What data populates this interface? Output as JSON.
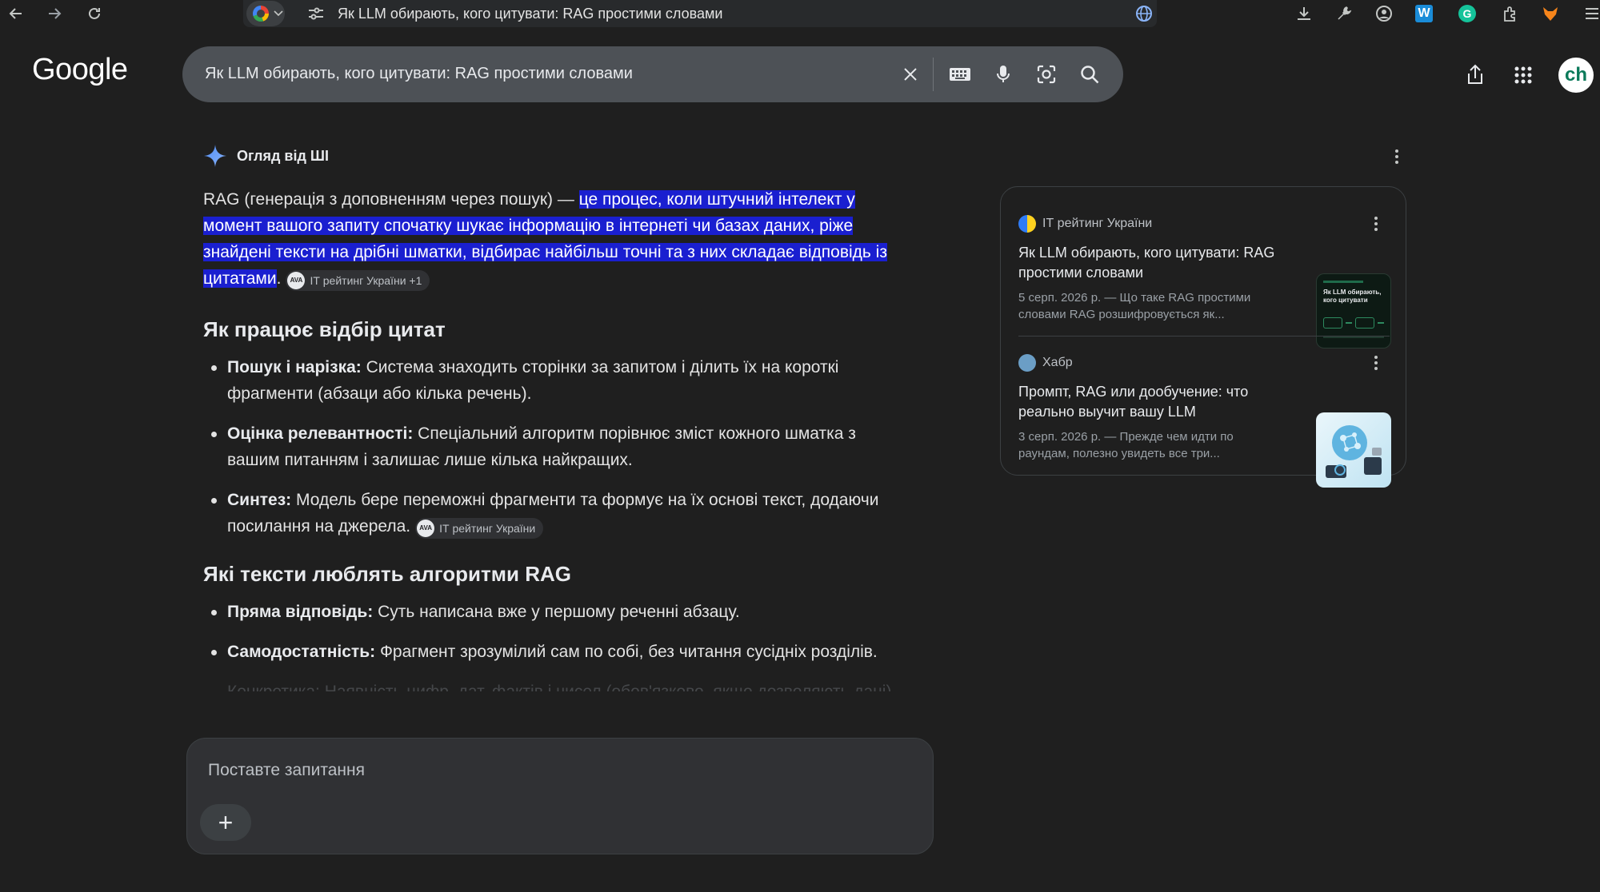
{
  "browser": {
    "tab_title": "Як LLM обирають, кого цитувати: RAG простими словами"
  },
  "google": {
    "logo": "Google",
    "search_query": "Як LLM обирають, кого цитувати: RAG простими словами",
    "avatar_text": "ch"
  },
  "ai_overview": {
    "title": "Огляд від ШІ",
    "intro_plain": "RAG (генерація з доповненням через пошук) — ",
    "intro_highlight": "це процес, коли штучний інтелект у момент вашого запиту спочатку шукає інформацію в інтернеті чи базах даних, ріже знайдені тексти на дрібні шматки, відбирає найбільш точні та з них складає відповідь із цитатами",
    "intro_end": ".",
    "intro_cite": "ІТ рейтинг України +1",
    "cite_badge": "AVA",
    "section1_title": "Як працює відбір цитат",
    "section1_items": [
      {
        "bold": "Пошук і нарізка:",
        "text": " Система знаходить сторінки за запитом і ділить їх на короткі фрагменти (абзаци або кілька речень)."
      },
      {
        "bold": "Оцінка релевантності:",
        "text": " Спеціальний алгоритм порівнює зміст кожного шматка з вашим питанням і залишає лише кілька найкращих."
      },
      {
        "bold": "Синтез:",
        "text": " Модель бере переможні фрагменти та формує на їх основі текст, додаючи посилання на джерела.",
        "cite": "ІТ рейтинг України"
      }
    ],
    "section2_title": "Які тексти люблять алгоритми RAG",
    "section2_items": [
      {
        "bold": "Пряма відповідь:",
        "text": " Суть написана вже у першому реченні абзацу."
      },
      {
        "bold": "Самодостатність:",
        "text": " Фрагмент зрозумілий сам по собі, без читання сусідніх розділів."
      }
    ],
    "faded_line": "Конкретика: Наявність цифр, дат, фактів і чисел (обов'язково, якщо дозволяють дані)",
    "ask_placeholder": "Поставте запитання",
    "ask_plus": "+"
  },
  "sources": [
    {
      "site": "ІТ рейтинг України",
      "title": "Як LLM обирають, кого цитувати: RAG простими словами",
      "snippet": "5 серп. 2026 р. — Що таке RAG простими словами RAG розшифровується як...",
      "thumb_text": "Як LLM обирають, кого цитувати"
    },
    {
      "site": "Хабр",
      "title": "Промпт, RAG или дообучение: что реально выучит вашу LLM",
      "snippet": "3 серп. 2026 р. — Прежде чем идти по раундам, полезно увидеть все три..."
    }
  ],
  "colors": {
    "background": "#1f1f1f",
    "highlight": "#1a1fd0",
    "search_box": "#4d5156"
  }
}
